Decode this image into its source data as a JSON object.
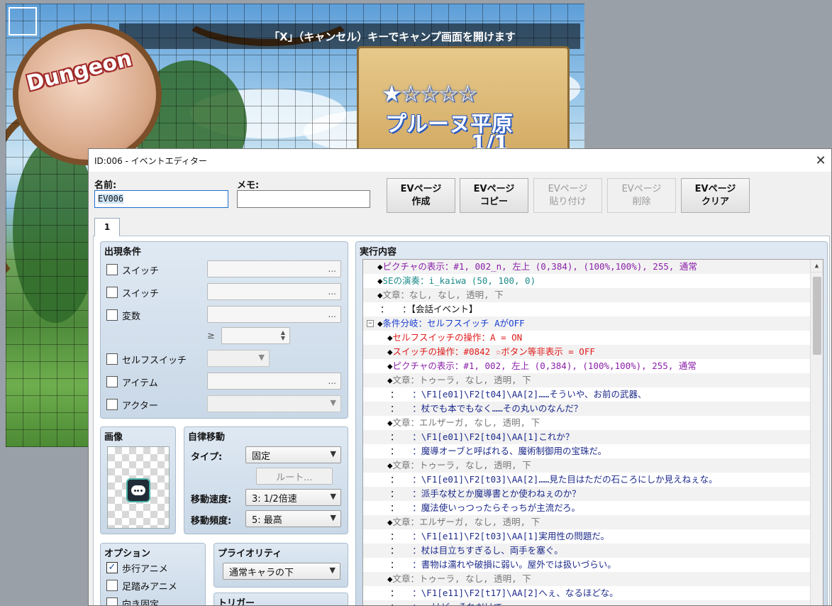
{
  "map": {
    "hint": "「X」（キャンセル）キーでキャンプ画面を開けます",
    "badge_text": "Dungeon",
    "stars": "★☆☆☆☆",
    "place_name": "プルーヌ平原",
    "floor_count": "1/1"
  },
  "dialog": {
    "title": "ID:006 - イベントエディター",
    "close": "✕",
    "name_label": "名前:",
    "name_value": "EV006",
    "memo_label": "メモ:",
    "memo_value": "",
    "page_buttons": [
      {
        "line1": "EVページ",
        "line2": "作成",
        "enabled": true
      },
      {
        "line1": "EVページ",
        "line2": "コピー",
        "enabled": true
      },
      {
        "line1": "EVページ",
        "line2": "貼り付け",
        "enabled": false
      },
      {
        "line1": "EVページ",
        "line2": "削除",
        "enabled": false
      },
      {
        "line1": "EVページ",
        "line2": "クリア",
        "enabled": true
      }
    ],
    "tab_label": "1"
  },
  "conditions": {
    "title": "出現条件",
    "switch1": "スイッチ",
    "switch2": "スイッチ",
    "variable": "変数",
    "gte": "≥",
    "self_switch": "セルフスイッチ",
    "item": "アイテム",
    "actor": "アクター",
    "ellipsis": "..."
  },
  "image": {
    "title": "画像"
  },
  "autonomous": {
    "title": "自律移動",
    "type_label": "タイプ:",
    "type_value": "固定",
    "route_button": "ルート...",
    "speed_label": "移動速度:",
    "speed_value": "3: 1/2倍速",
    "freq_label": "移動頻度:",
    "freq_value": "5: 最高"
  },
  "options": {
    "title": "オプション",
    "walk_anim": "歩行アニメ",
    "walk_anim_checked": "✓",
    "step_anim": "足踏みアニメ",
    "dir_fix": "向き固定"
  },
  "priority": {
    "title": "プライオリティ",
    "value": "通常キャラの下"
  },
  "trigger": {
    "title": "トリガー"
  },
  "contents": {
    "title": "実行内容",
    "lines": [
      {
        "prefix": "◆",
        "head": "ピクチャの表示",
        "body": "：#1, 002_n, 左上 (0,384), (100%,100%), 255, 通常",
        "color": "#8a1fa8",
        "indent": 20,
        "exp": ""
      },
      {
        "prefix": "◆",
        "head": "SEの演奏",
        "body": "：i_kaiwa (50, 100, 0)",
        "color": "#1b8a8a",
        "indent": 20,
        "exp": ""
      },
      {
        "prefix": "◆",
        "head": "文章",
        "body": "：なし, なし, 透明, 下",
        "color": "#777777",
        "indent": 20,
        "exp": ""
      },
      {
        "prefix": "：",
        "head": "",
        "body": "　　：【会話イベント】",
        "color": "#111111",
        "indent": 24,
        "exp": ""
      },
      {
        "prefix": "◆",
        "head": "条件分岐",
        "body": "：セルフスイッチ AがOFF",
        "color": "#1a3fd1",
        "indent": 20,
        "exp": "⊟"
      },
      {
        "prefix": "◆",
        "head": "セルフスイッチの操作",
        "body": "：A = ON",
        "color": "#e01b1b",
        "indent": 34,
        "exp": ""
      },
      {
        "prefix": "◆",
        "head": "スイッチの操作",
        "body": "：#0842 ☆ボタン等非表示 = OFF",
        "color": "#e01b1b",
        "indent": 34,
        "exp": ""
      },
      {
        "prefix": "◆",
        "head": "ピクチャの表示",
        "body": "：#1, 002, 左上 (0,384), (100%,100%), 255, 通常",
        "color": "#8a1fa8",
        "indent": 34,
        "exp": ""
      },
      {
        "prefix": "◆",
        "head": "文章",
        "body": "：トゥーラ, なし, 透明, 下",
        "color": "#777777",
        "indent": 34,
        "exp": ""
      },
      {
        "prefix": "：",
        "head": "",
        "body": "　　：\\F1[e01]\\F2[t04]\\AA[2]……そういや、お前の武器、",
        "color": "#1c2a8a",
        "indent": 38,
        "exp": ""
      },
      {
        "prefix": "：",
        "head": "",
        "body": "　　：杖でも本でもなく……その丸いのなんだ？",
        "color": "#1c2a8a",
        "indent": 38,
        "exp": ""
      },
      {
        "prefix": "◆",
        "head": "文章",
        "body": "：エルザーガ, なし, 透明, 下",
        "color": "#777777",
        "indent": 34,
        "exp": ""
      },
      {
        "prefix": "：",
        "head": "",
        "body": "　　：\\F1[e01]\\F2[t04]\\AA[1]これか？",
        "color": "#1c2a8a",
        "indent": 38,
        "exp": ""
      },
      {
        "prefix": "：",
        "head": "",
        "body": "　　：魔導オーブと呼ばれる、魔術制御用の宝珠だ。",
        "color": "#1c2a8a",
        "indent": 38,
        "exp": ""
      },
      {
        "prefix": "◆",
        "head": "文章",
        "body": "：トゥーラ, なし, 透明, 下",
        "color": "#777777",
        "indent": 34,
        "exp": ""
      },
      {
        "prefix": "：",
        "head": "",
        "body": "　　：\\F1[e01]\\F2[t03]\\AA[2]……見た目はただの石ころにしか見えねぇな。",
        "color": "#1c2a8a",
        "indent": 38,
        "exp": ""
      },
      {
        "prefix": "：",
        "head": "",
        "body": "　　：派手な杖とか魔導書とか使わねぇのか？",
        "color": "#1c2a8a",
        "indent": 38,
        "exp": ""
      },
      {
        "prefix": "：",
        "head": "",
        "body": "　　：魔法使いっつったらそっちが主流だろ。",
        "color": "#1c2a8a",
        "indent": 38,
        "exp": ""
      },
      {
        "prefix": "◆",
        "head": "文章",
        "body": "：エルザーガ, なし, 透明, 下",
        "color": "#777777",
        "indent": 34,
        "exp": ""
      },
      {
        "prefix": "：",
        "head": "",
        "body": "　　：\\F1[e11]\\F2[t03]\\AA[1]実用性の問題だ。",
        "color": "#1c2a8a",
        "indent": 38,
        "exp": ""
      },
      {
        "prefix": "：",
        "head": "",
        "body": "　　：杖は目立ちすぎるし、両手を塞ぐ。",
        "color": "#1c2a8a",
        "indent": 38,
        "exp": ""
      },
      {
        "prefix": "：",
        "head": "",
        "body": "　　：書物は濡れや破損に弱い。屋外では扱いづらい。",
        "color": "#1c2a8a",
        "indent": 38,
        "exp": ""
      },
      {
        "prefix": "◆",
        "head": "文章",
        "body": "：トゥーラ, なし, 透明, 下",
        "color": "#777777",
        "indent": 34,
        "exp": ""
      },
      {
        "prefix": "：",
        "head": "",
        "body": "　　：\\F1[e11]\\F2[t17]\\AA[2]へぇ、なるほどな。",
        "color": "#1c2a8a",
        "indent": 38,
        "exp": ""
      },
      {
        "prefix": "：",
        "head": "",
        "body": "　　：……けど、それだけで",
        "color": "#1c2a8a",
        "indent": 38,
        "exp": ""
      }
    ]
  }
}
